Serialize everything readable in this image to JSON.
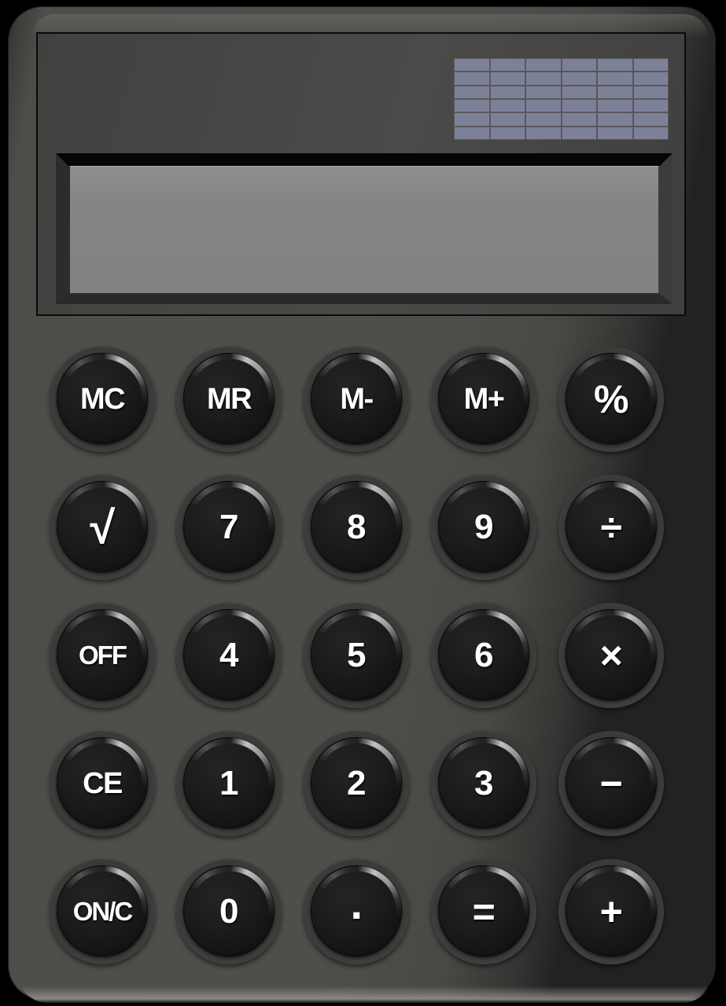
{
  "device": {
    "type": "desktop-calculator",
    "body_color": "#4a4a48",
    "panel_color": "#474745",
    "key_cap_color": "#141414",
    "key_label_color": "#ffffff",
    "lcd_color": "#858585",
    "solar_cell_color": "#7d8198"
  },
  "solar_panel": {
    "name": "solar-cell-array",
    "columns": 6,
    "rows": 6,
    "cell_count": 36
  },
  "display": {
    "value": "",
    "placeholder": "",
    "indicators": []
  },
  "keypad": {
    "columns": 5,
    "rows": 5,
    "keys": [
      {
        "label": "MC",
        "name": "memory-clear-button",
        "size": "sm"
      },
      {
        "label": "MR",
        "name": "memory-recall-button",
        "size": "sm"
      },
      {
        "label": "M-",
        "name": "memory-subtract-button",
        "size": "sm"
      },
      {
        "label": "M+",
        "name": "memory-add-button",
        "size": "sm"
      },
      {
        "label": "%",
        "name": "percent-button",
        "size": "op"
      },
      {
        "label": "√",
        "name": "square-root-button",
        "size": "sqrt"
      },
      {
        "label": "7",
        "name": "digit-7-button",
        "size": ""
      },
      {
        "label": "8",
        "name": "digit-8-button",
        "size": ""
      },
      {
        "label": "9",
        "name": "digit-9-button",
        "size": ""
      },
      {
        "label": "÷",
        "name": "divide-button",
        "size": "op"
      },
      {
        "label": "OFF",
        "name": "power-off-button",
        "size": "xs"
      },
      {
        "label": "4",
        "name": "digit-4-button",
        "size": ""
      },
      {
        "label": "5",
        "name": "digit-5-button",
        "size": ""
      },
      {
        "label": "6",
        "name": "digit-6-button",
        "size": ""
      },
      {
        "label": "×",
        "name": "multiply-button",
        "size": "op"
      },
      {
        "label": "CE",
        "name": "clear-entry-button",
        "size": "sm"
      },
      {
        "label": "1",
        "name": "digit-1-button",
        "size": ""
      },
      {
        "label": "2",
        "name": "digit-2-button",
        "size": ""
      },
      {
        "label": "3",
        "name": "digit-3-button",
        "size": ""
      },
      {
        "label": "−",
        "name": "subtract-button",
        "size": "op"
      },
      {
        "label": "ON/C",
        "name": "power-on-clear-button",
        "size": "xs"
      },
      {
        "label": "0",
        "name": "digit-0-button",
        "size": ""
      },
      {
        "label": ".",
        "name": "decimal-point-button",
        "size": "dot"
      },
      {
        "label": "=",
        "name": "equals-button",
        "size": "op"
      },
      {
        "label": "+",
        "name": "add-button",
        "size": "op"
      }
    ]
  },
  "geometry": {
    "column_centers": [
      130,
      291,
      453,
      615,
      777
    ],
    "row_centers": [
      508,
      671,
      834,
      997,
      1160
    ],
    "key_diameter": 134
  }
}
